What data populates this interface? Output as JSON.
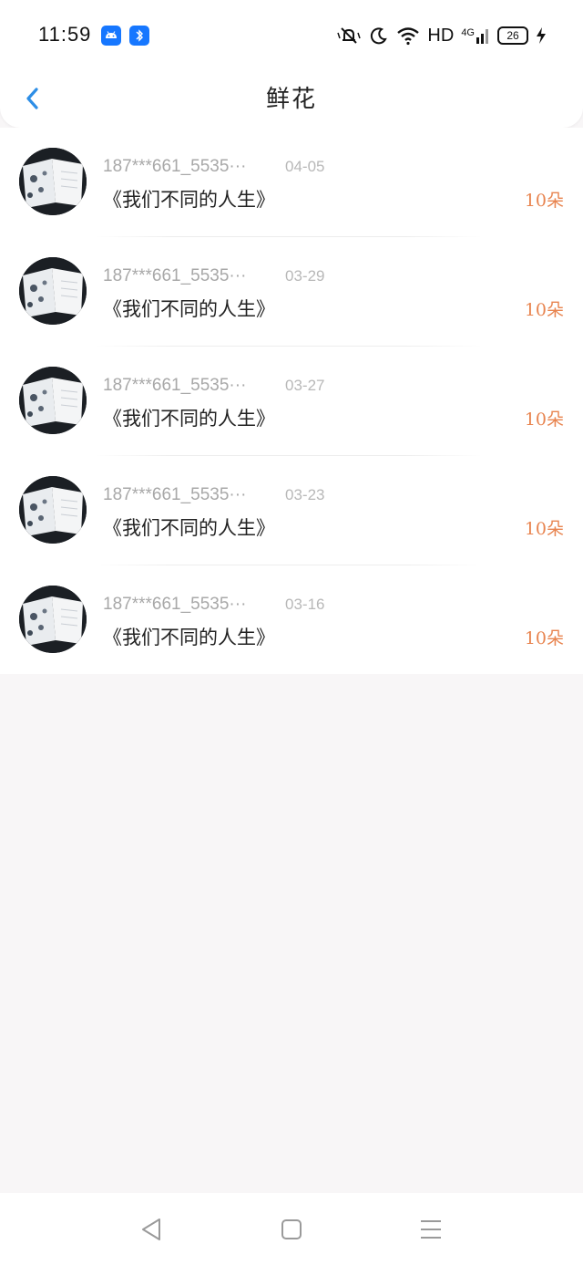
{
  "status_bar": {
    "time": "11:59",
    "notifications": [
      "android-icon",
      "bluetooth-file-icon"
    ],
    "icons": [
      "mute-icon",
      "moon-icon",
      "wifi-icon"
    ],
    "hd": "HD",
    "network": "4G",
    "battery": "26"
  },
  "header": {
    "title": "鲜花",
    "accent_color": "#2d8ee6"
  },
  "records": [
    {
      "name": "187***661_5535···",
      "date": "04-05",
      "title": "《我们不同的人生》",
      "count": "10朵"
    },
    {
      "name": "187***661_5535···",
      "date": "03-29",
      "title": "《我们不同的人生》",
      "count": "10朵"
    },
    {
      "name": "187***661_5535···",
      "date": "03-27",
      "title": "《我们不同的人生》",
      "count": "10朵"
    },
    {
      "name": "187***661_5535···",
      "date": "03-23",
      "title": "《我们不同的人生》",
      "count": "10朵"
    },
    {
      "name": "187***661_5535···",
      "date": "03-16",
      "title": "《我们不同的人生》",
      "count": "10朵"
    }
  ],
  "colors": {
    "count": "#e8844f",
    "background": "#f8f6f7"
  },
  "system_nav": [
    "back-icon",
    "home-icon",
    "menu-icon"
  ]
}
